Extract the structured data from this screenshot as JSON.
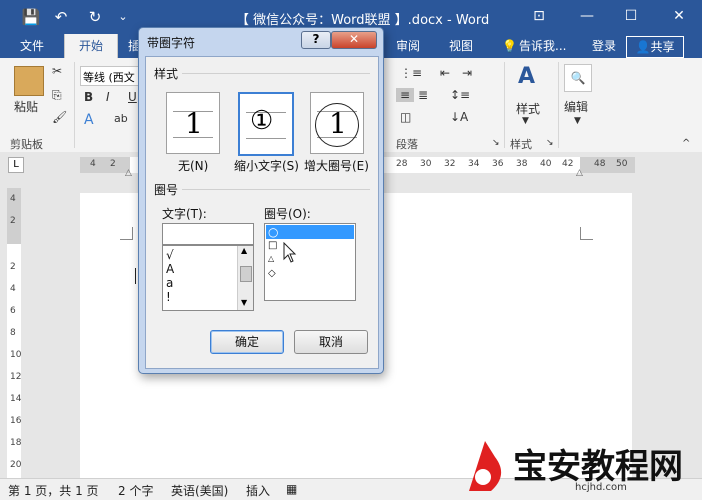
{
  "titlebar": {
    "title": "【 微信公众号：Word联盟 】.docx - Word",
    "save_icon": "💾",
    "undo_icon": "↶",
    "redo_icon": "↻",
    "customize_icon": "⌄",
    "ribbon_display_icon": "⊡",
    "minimize_icon": "—",
    "maximize_icon": "☐",
    "close_icon": "✕"
  },
  "tabs": {
    "file": "文件",
    "home": "开始",
    "insert": "插",
    "review": "审阅",
    "view": "视图",
    "tell_me": "告诉我...",
    "sign_in": "登录",
    "share": "共享"
  },
  "ribbon": {
    "paste_label": "粘贴",
    "clipboard_label": "剪贴板",
    "font_name": "等线 (西文",
    "bold": "B",
    "italic": "I",
    "underline": "U",
    "paragraph_label": "段落",
    "styles_label": "样式",
    "styles_group_label": "样式",
    "editing_label": "编辑"
  },
  "ruler": {
    "left_numbers": [
      "4",
      "2"
    ],
    "right_numbers": [
      "28",
      "30",
      "32",
      "34",
      "36",
      "38",
      "40",
      "42",
      "",
      "48",
      "50"
    ],
    "vertical_numbers": [
      "4",
      "2",
      "",
      "2",
      "4",
      "6",
      "8",
      "10",
      "12",
      "14",
      "16",
      "18",
      "20"
    ],
    "tab_icon": "L"
  },
  "status": {
    "page": "第 1 页，共 1 页",
    "words": "2 个字",
    "language": "英语(美国)",
    "mode": "插入"
  },
  "watermark": {
    "text": "宝安教程网",
    "url": "hcjhd.com"
  },
  "dialog": {
    "title": "带圈字符",
    "help": "?",
    "close": "✕",
    "style_section": "样式",
    "styles": [
      {
        "glyph": "1",
        "label": "无(N)",
        "selected": false
      },
      {
        "glyph": "①",
        "label": "缩小文字(S)",
        "selected": true
      },
      {
        "glyph": "1",
        "label": "增大圈号(E)",
        "selected": false
      }
    ],
    "enclosure_section": "圈号",
    "text_label": "文字(T):",
    "text_value": "",
    "text_list": [
      "√",
      "A",
      "a",
      "!"
    ],
    "circle_label": "圈号(O):",
    "circle_list": [
      "○",
      "□",
      "△",
      "◇"
    ],
    "ok": "确定",
    "cancel": "取消"
  }
}
